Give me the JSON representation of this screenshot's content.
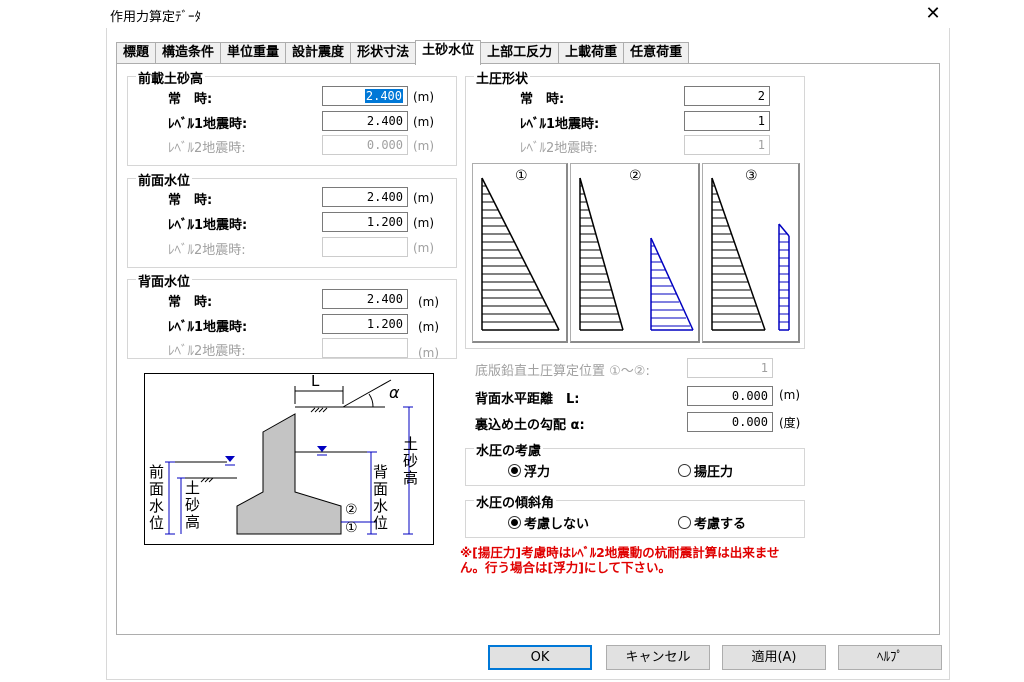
{
  "window": {
    "title": "作用力算定ﾃﾞｰﾀ",
    "close_glyph": "✕"
  },
  "tabs": [
    "標題",
    "構造条件",
    "単位重量",
    "設計震度",
    "形状寸法",
    "土砂水位",
    "上部工反力",
    "上載荷重",
    "任意荷重"
  ],
  "active_tab": "土砂水位",
  "front_soil": {
    "title": "前載土砂高",
    "rows": [
      {
        "label": "常　時:",
        "value": "2.400",
        "unit": "(m)"
      },
      {
        "label": "ﾚﾍﾞﾙ1地震時:",
        "value": "2.400",
        "unit": "(m)"
      },
      {
        "label": "ﾚﾍﾞﾙ2地震時:",
        "value": "0.000",
        "unit": "(m)"
      }
    ]
  },
  "front_water": {
    "title": "前面水位",
    "rows": [
      {
        "label": "常　時:",
        "value": "2.400",
        "unit": "(m)"
      },
      {
        "label": "ﾚﾍﾞﾙ1地震時:",
        "value": "1.200",
        "unit": "(m)"
      },
      {
        "label": "ﾚﾍﾞﾙ2地震時:",
        "value": "",
        "unit": "(m)"
      }
    ]
  },
  "back_water": {
    "title": "背面水位",
    "rows": [
      {
        "label": "常　時:",
        "value": "2.400",
        "unit": "(m)"
      },
      {
        "label": "ﾚﾍﾞﾙ1地震時:",
        "value": "1.200",
        "unit": "(m)"
      },
      {
        "label": "ﾚﾍﾞﾙ2地震時:",
        "value": "",
        "unit": "(m)"
      }
    ]
  },
  "earth_shape": {
    "title": "土圧形状",
    "rows": [
      {
        "label": "常　時:",
        "value": "2"
      },
      {
        "label": "ﾚﾍﾞﾙ1地震時:",
        "value": "1"
      },
      {
        "label": "ﾚﾍﾞﾙ2地震時:",
        "value": "1"
      }
    ],
    "option_labels": [
      "①",
      "②",
      "③"
    ]
  },
  "vertical_position": {
    "label": "底版鉛直土圧算定位置 ①～②:",
    "value": "1"
  },
  "back_distance": {
    "label": "背面水平距離　L:",
    "value": "0.000",
    "unit": "(m)"
  },
  "backfill_slope": {
    "label": "裏込め土の勾配 α:",
    "value": "0.000",
    "unit": "(度)"
  },
  "water_pressure": {
    "title": "水圧の考慮",
    "options": [
      "浮力",
      "揚圧力"
    ],
    "selected": 0
  },
  "water_incline": {
    "title": "水圧の傾斜角",
    "options": [
      "考慮しない",
      "考慮する"
    ],
    "selected": 0
  },
  "note": "※[揚圧力]考慮時はﾚﾍﾞﾙ2地震動の杭耐震計算は出来ません。行う場合は[浮力]にして下さい。",
  "diagram": {
    "L": "L",
    "alpha": "α",
    "front_water_label": [
      "前",
      "面",
      "水",
      "位"
    ],
    "front_soil_label": [
      "土",
      "砂",
      "高"
    ],
    "back_water_label": [
      "背",
      "面",
      "水",
      "位"
    ],
    "back_soil_label": [
      "土",
      "砂",
      "高"
    ],
    "circle_2": "②",
    "circle_1": "①"
  },
  "buttons": {
    "ok": "OK",
    "cancel": "キャンセル",
    "apply": "適用(A)",
    "help": "ﾍﾙﾌﾟ"
  }
}
